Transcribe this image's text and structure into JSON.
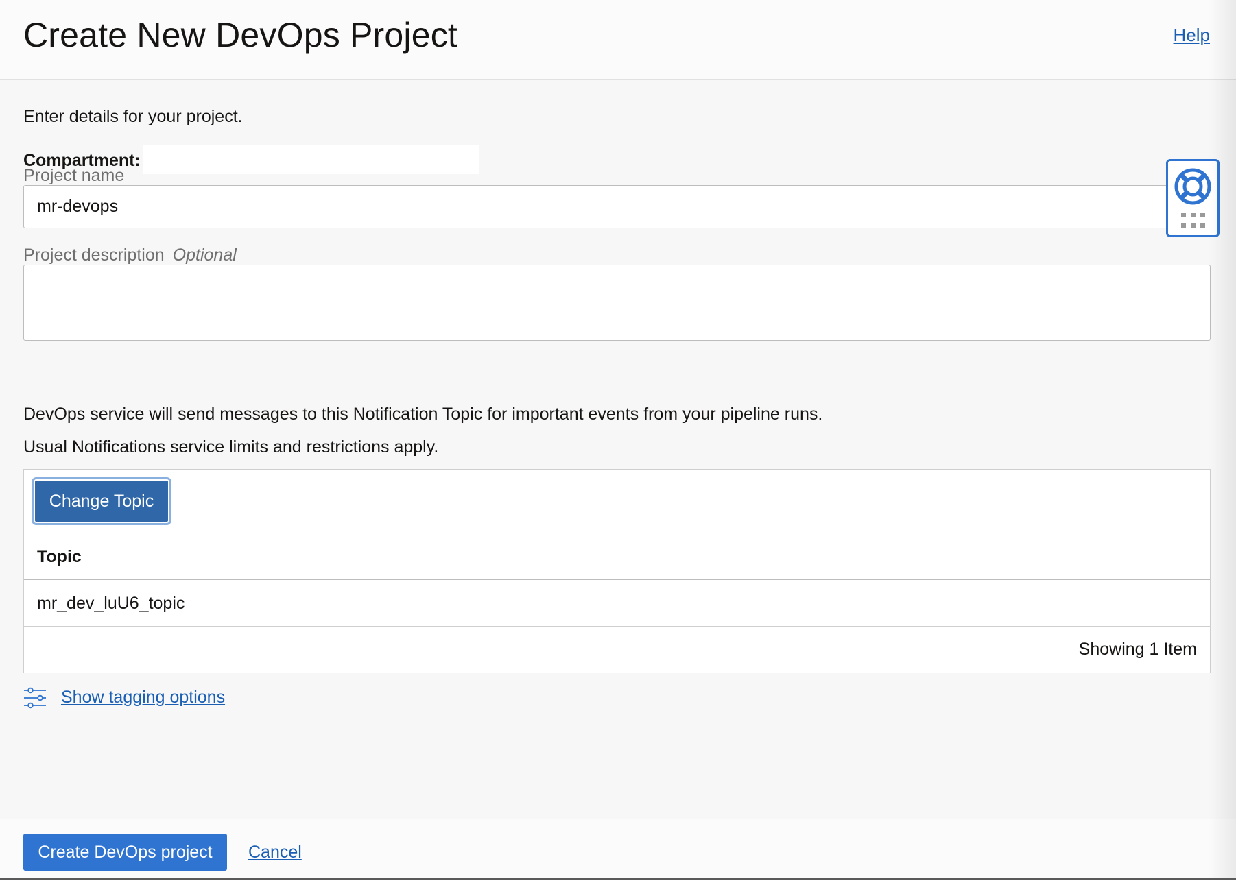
{
  "header": {
    "title": "Create New DevOps Project",
    "help_label": "Help"
  },
  "form": {
    "intro": "Enter details for your project.",
    "compartment_label": "Compartment:",
    "project_name_label": "Project name",
    "project_name_value": "mr-devops",
    "project_description_label": "Project description",
    "optional_label": "Optional",
    "project_description_value": ""
  },
  "notification": {
    "line1": "DevOps service will send messages to this Notification Topic for important events from your pipeline runs.",
    "line2": "Usual Notifications service limits and restrictions apply."
  },
  "topic_table": {
    "change_topic_label": "Change Topic",
    "columns": [
      "Topic"
    ],
    "rows": [
      [
        "mr_dev_luU6_topic"
      ]
    ],
    "footer": "Showing 1 Item"
  },
  "tagging": {
    "link_label": "Show tagging options",
    "icon": "sliders-icon"
  },
  "footer": {
    "create_label": "Create DevOps project",
    "cancel_label": "Cancel"
  },
  "widgets": {
    "help_widget_icon": "lifebuoy-icon"
  },
  "colors": {
    "primary": "#2f74d0",
    "secondary_button": "#2f67a8",
    "link": "#1a5fb4"
  }
}
